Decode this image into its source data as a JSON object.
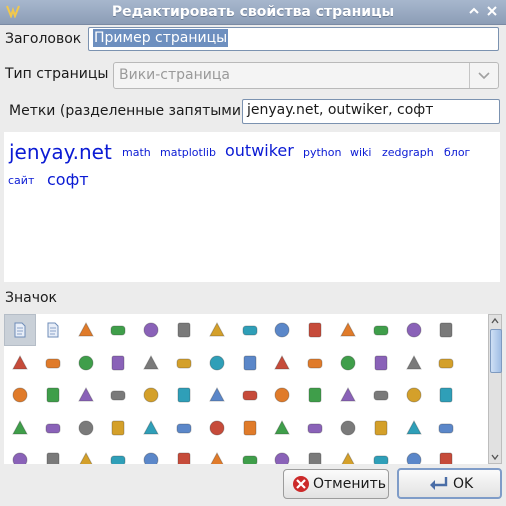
{
  "window": {
    "title": "Редактировать свойства страницы"
  },
  "form": {
    "title_label": "Заголовок",
    "title_value": "Пример страницы",
    "type_label": "Тип страницы",
    "type_value": "Вики-страница",
    "tags_label": "Метки (разделенные запятыми)",
    "tags_value": "jenyay.net, outwiker, софт"
  },
  "tag_cloud": {
    "tags": [
      "jenyay.net",
      "math",
      "matplotlib",
      "outwiker",
      "python",
      "wiki",
      "zedgraph",
      "блог",
      "сайт",
      "софт"
    ]
  },
  "icons": {
    "label": "Значок",
    "items": [
      "page-icon",
      "page-alt-icon",
      "check-green-icon",
      "add-green-icon",
      "book-open-icon",
      "address-book-icon",
      "anchor-icon",
      "monitor-chart-icon",
      "asterisk-orange-icon",
      "paperclip-icon",
      "award-star-icon",
      "bubbles-icon",
      "comment-yellow-icon",
      "facebook-icon",
      "bubble-blue-icon",
      "bubble-white-icon",
      "bubble-speech-icon",
      "bandage-icon",
      "bank-icon",
      "battery-icon",
      "battery-low-icon",
      "battery-half-icon",
      "battery-green-icon",
      "battery-full-icon",
      "battery-charge-icon",
      "battery-plug-icon",
      "bean-icon",
      "bell-icon",
      "bomb-icon",
      "book-brown-icon",
      "book-open-alt-icon",
      "book-help-icon",
      "book-blue-icon",
      "book-edit-icon",
      "book-open-blue-icon",
      "books-icon",
      "books-stack-icon",
      "chrome-icon",
      "firefox-icon",
      "ie-icon",
      "opera-icon",
      "safari-icon",
      "bug-icon",
      "warning-icon",
      "cake-icon",
      "calculator-icon",
      "calendar-icon",
      "camera-icon",
      "cancel-icon",
      "cart-icon",
      "layers-icon",
      "cd-icon",
      "chart-down-icon",
      "chart-up-icon",
      "chart-bar-icon",
      "chart-line-icon",
      "tree-icon",
      "globe-icon",
      "clock-icon",
      "clock-red-icon",
      "cog-icon",
      "color-wheel-icon",
      "clipboard-icon",
      "computer-icon",
      "connect-icon",
      "brush-icon",
      "contrast-icon",
      "monitor-icon",
      "cursor-icon",
      "cut-icon"
    ]
  },
  "buttons": {
    "cancel": "Отменить",
    "ok": "OK"
  },
  "colors": {
    "titlebar": "#97a8c0",
    "tag_link": "#0b1bd4",
    "selection": "#6d8fbf"
  }
}
